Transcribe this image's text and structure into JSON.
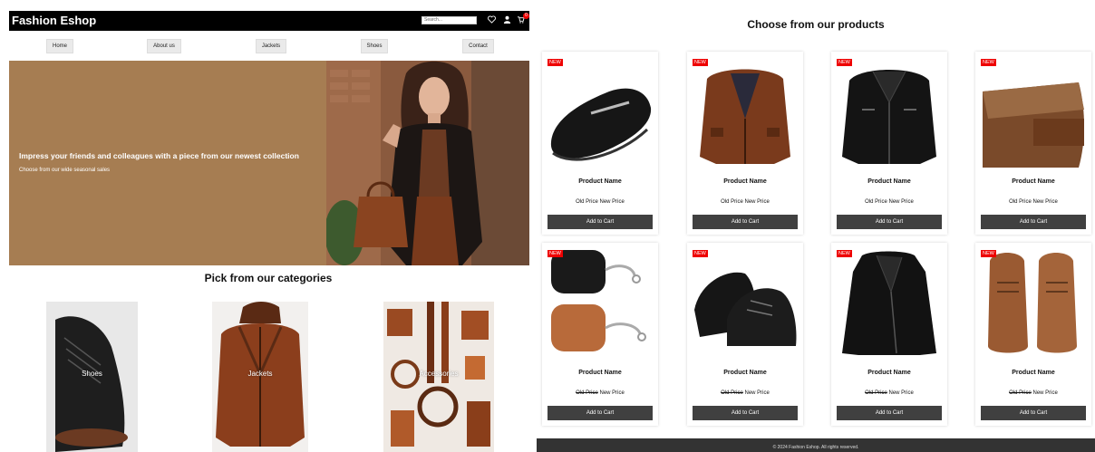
{
  "header": {
    "brand": "Fashion Eshop",
    "search_placeholder": "Search...",
    "cart_count": "0",
    "icons": [
      "heart-icon",
      "user-icon",
      "cart-icon"
    ]
  },
  "nav": [
    "Home",
    "About us",
    "Jackets",
    "Shoes",
    "Contact"
  ],
  "hero": {
    "title": "Impress your friends and colleagues with a piece from our newest collection",
    "subtitle": "Choose from our wide seasonal sales"
  },
  "categories": {
    "title": "Pick from our categories",
    "items": [
      "Shoes",
      "Jackets",
      "Accessories"
    ]
  },
  "products": {
    "title": "Choose from our products",
    "badge": "NEW",
    "name": "Product Name",
    "old_price": "Old Price",
    "new_price": "New Price",
    "add_label": "Add to Cart",
    "items": [
      {
        "type": "loafer",
        "old_struck": false
      },
      {
        "type": "brown-jacket",
        "old_struck": false
      },
      {
        "type": "black-jacket",
        "old_struck": false
      },
      {
        "type": "wallet",
        "old_struck": false
      },
      {
        "type": "airpods-case",
        "old_struck": true
      },
      {
        "type": "oxford-shoes",
        "old_struck": true
      },
      {
        "type": "black-jacket-2",
        "old_struck": true
      },
      {
        "type": "brown-shoes",
        "old_struck": true
      }
    ]
  },
  "footer": {
    "text": "© 2024 Fashion Eshop. All rights reserved."
  },
  "colors": {
    "topbar": "#000000",
    "hero_bg": "#a67d52",
    "badge": "#e00000",
    "button": "#404040",
    "footer": "#333333"
  }
}
